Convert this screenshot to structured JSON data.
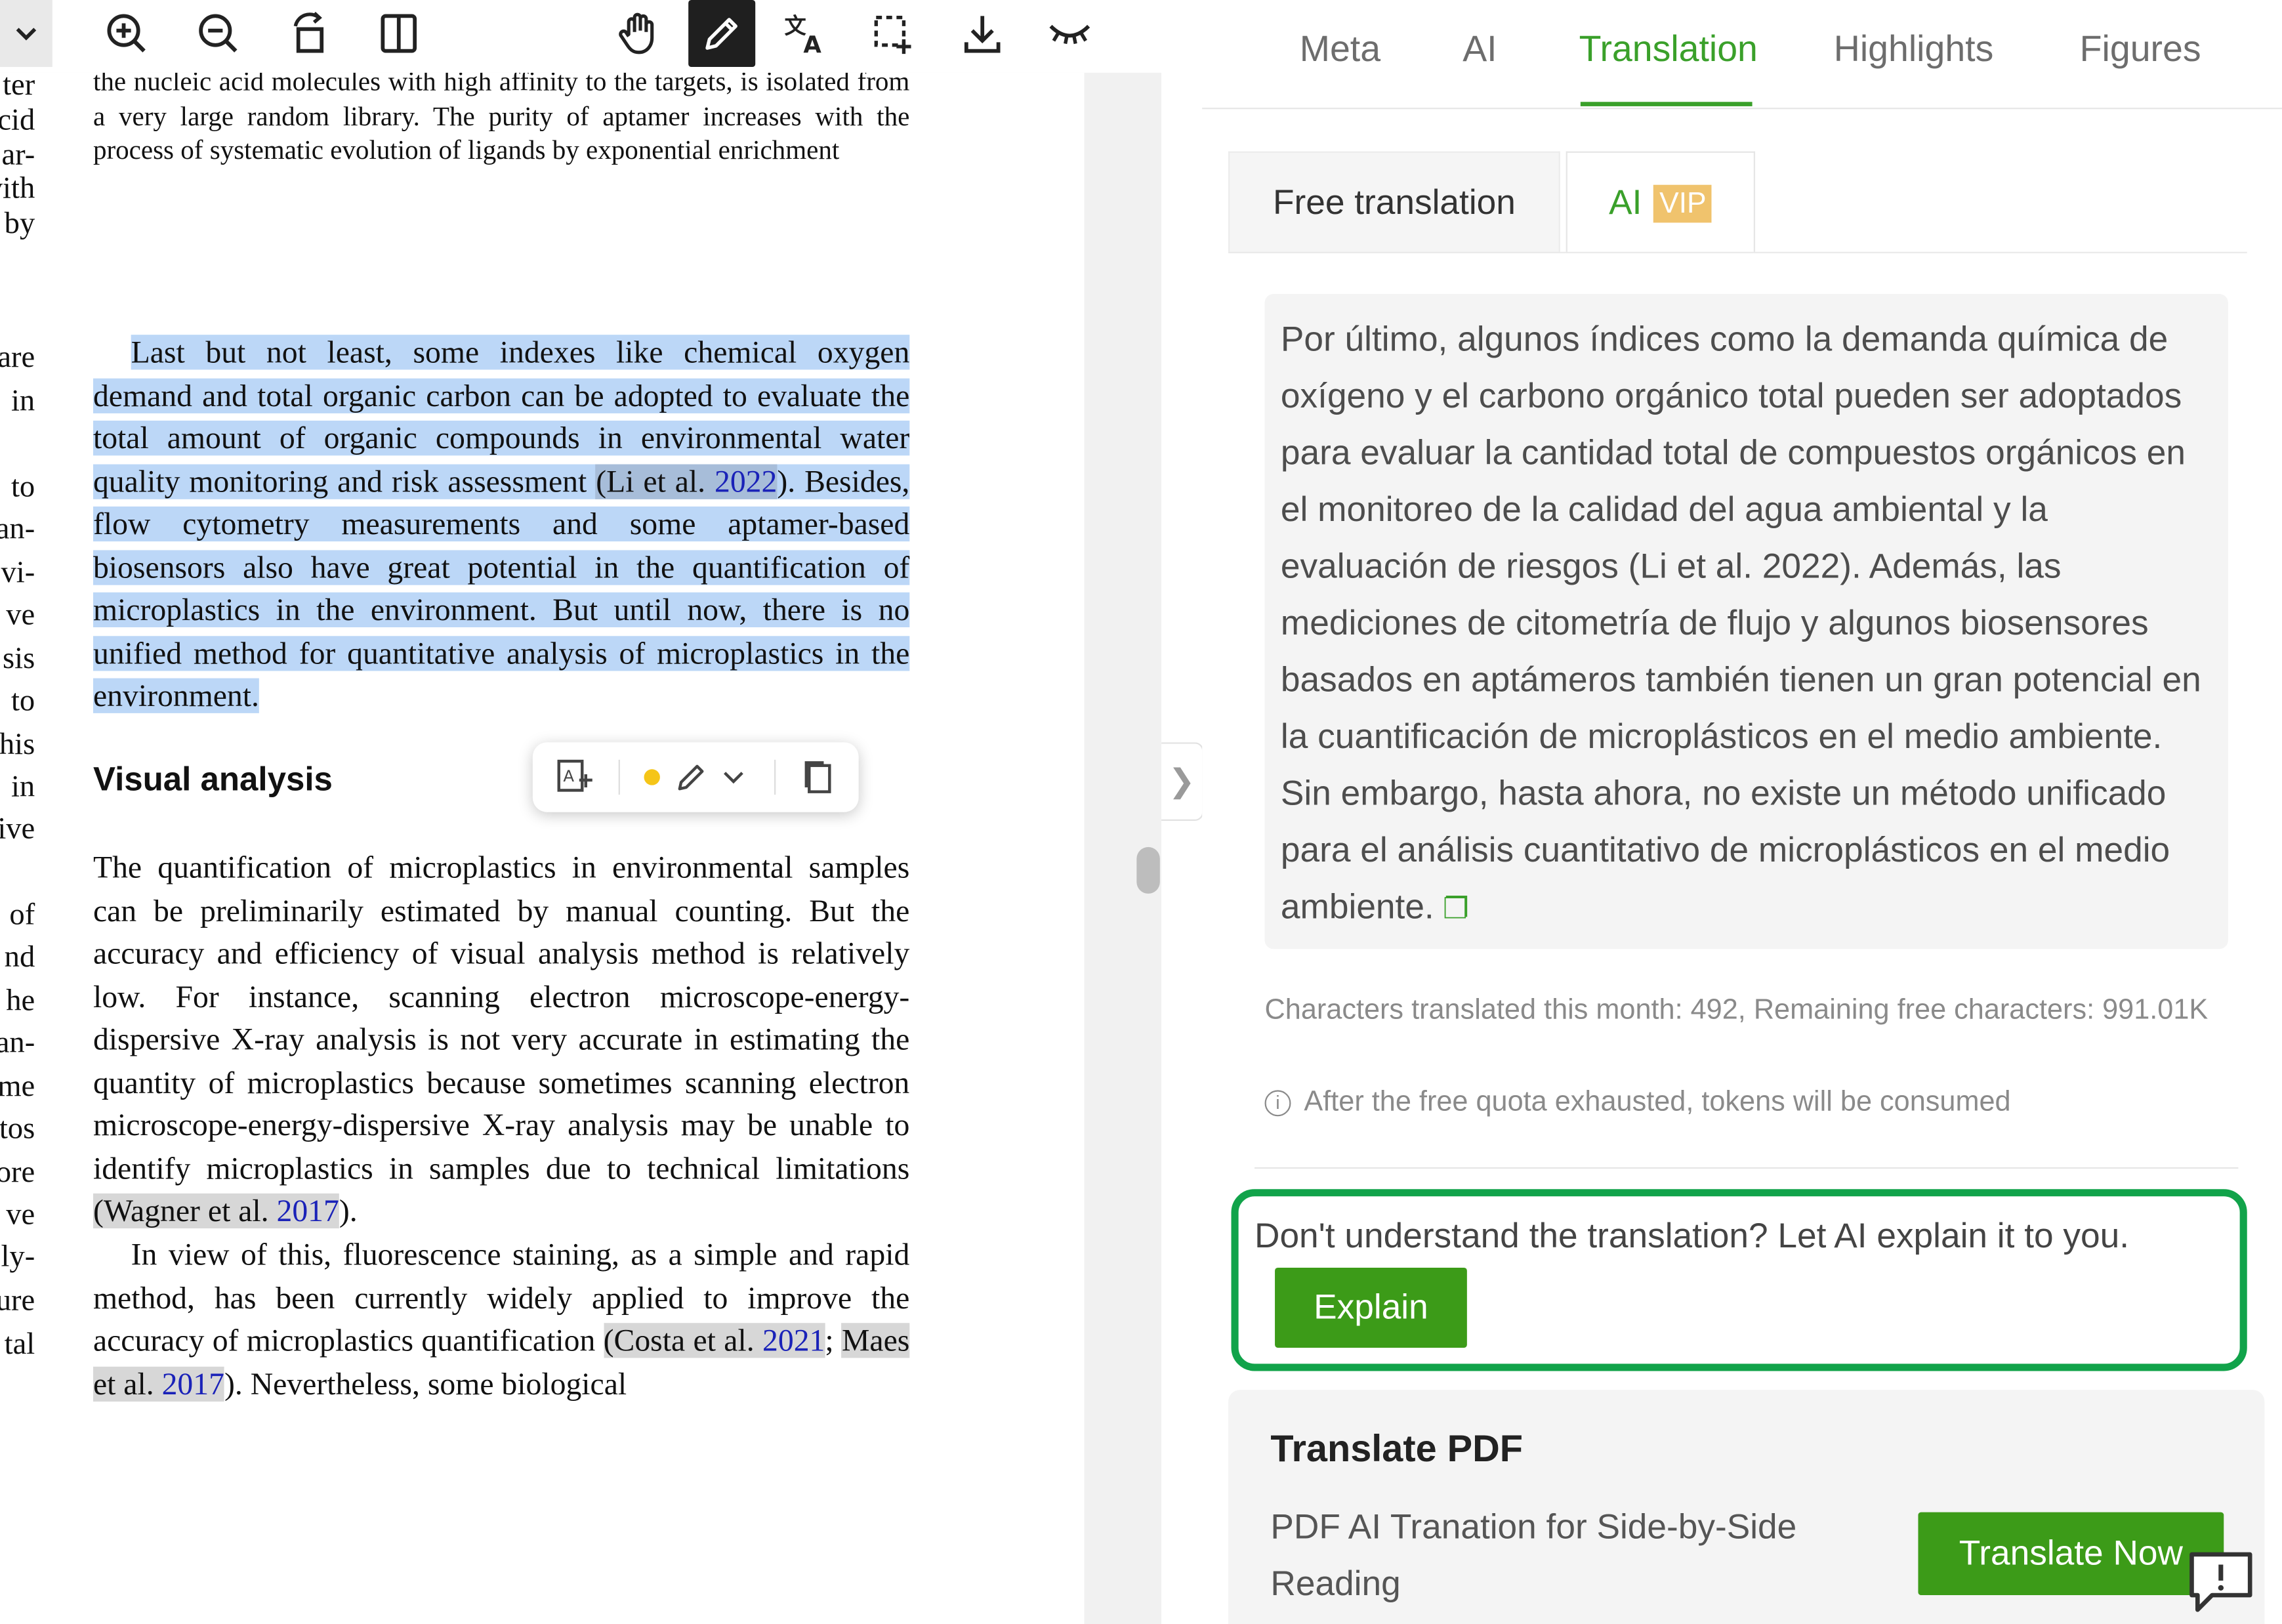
{
  "viewer": {
    "toolbar": {
      "dropdown_glyph": "⌄",
      "tools": [
        "zoom-in-icon",
        "zoom-out-icon",
        "rotate-icon",
        "split-view-icon",
        "hand-tool-icon",
        "pencil-icon",
        "translate-icon",
        "selection-icon",
        "download-icon",
        "hide-icon"
      ],
      "active_tool": "pencil-icon"
    },
    "left_column_fragments": [
      "ter",
      "cid",
      "ar-",
      "vith",
      "by",
      "are",
      "in",
      "to",
      "an-",
      "vi-",
      "ve",
      "sis",
      "to",
      "his",
      "in",
      "ive",
      "of",
      "nd",
      "he",
      "an-",
      "me",
      "tos",
      "ore",
      "ve",
      "ly-",
      "ure",
      "tal"
    ],
    "top_paragraph": "the nucleic acid molecules with high affinity to the targets, is isolated from a very large random library. The purity of aptamer increases with the process of systematic evolution of ligands by exponential enrichment",
    "selected_paragraph": {
      "text_a": "Last but not least, some indexes like chemical oxygen demand and total organic carbon can be adopted to evaluate the total amount of organic compounds in environmental water quality monitoring and risk assessment ",
      "cite_open": "(Li et al.",
      "cite_year": "2022",
      "text_b": "). Besides, flow cytometry measurements and some aptamer-based biosensors also have great potential in the quantification of microplastics in the environment. But until now, there is no unified method for quantitative analysis of microplastics in the environment."
    },
    "heading": "Visual analysis",
    "quant_paragraph": {
      "text": "The quantification of microplastics in environmental samples can be preliminarily estimated by manual counting. But the accuracy and efficiency of visual analysis method is relatively low. For instance, scanning electron microscope-energy-dispersive X-ray analysis is not very accurate in estimating the quantity of microplastics because sometimes scanning electron microscope-energy-dispersive X-ray analysis may be unable to identify microplastics in samples due to technical limitations ",
      "cite_author": "(Wagner et al. ",
      "cite_year": "2017",
      "cite_close": ")."
    },
    "view_paragraph": {
      "text": "In view of this, fluorescence staining, as a simple and rapid method, has been currently widely applied to improve the accuracy of microplastics quantification ",
      "cite1_author": "(Costa et al.",
      "cite1_year": "2021",
      "sep": "; ",
      "cite2_author": "Maes et al. ",
      "cite2_year": "2017",
      "tail": "). Nevertheless, some biological"
    },
    "floating_toolbar": [
      "translate-icon",
      "color-dot",
      "pencil-icon",
      "chevron-down-icon",
      "copy-icon"
    ],
    "collapse_glyph": "❯"
  },
  "panel": {
    "tabs": [
      {
        "label": "Meta"
      },
      {
        "label": "AI"
      },
      {
        "label": "Translation"
      },
      {
        "label": "Highlights"
      },
      {
        "label": "Figures"
      }
    ],
    "active_tab": "Translation",
    "subtabs": {
      "free": "Free translation",
      "ai": "AI",
      "vip": "VIP"
    },
    "translation_text": "Por último, algunos índices como la demanda química de oxígeno y el carbono orgánico total pueden ser adoptados para evaluar la cantidad total de compuestos orgánicos en el monitoreo de la calidad del agua ambiental y la evaluación de riesgos (Li et al. 2022). Además, las mediciones de citometría de flujo y algunos biosensores basados en aptámeros también tienen un gran potencial en la cuantificación de microplásticos en el medio ambiente. Sin embargo, hasta ahora, no existe un método unificado para el análisis cuantitativo de microplásticos en el medio ambiente.",
    "quota_text": "Characters translated this month: 492,  Remaining free characters: 991.01K",
    "info_text": "After the free quota exhausted, tokens will be consumed",
    "explain_prompt": "Don't understand the translation? Let AI explain it to you.",
    "explain_button": "Explain",
    "pdf_card": {
      "title": "Translate PDF",
      "description": "PDF AI Tranation for Side-by-Side Reading",
      "button": "Translate Now"
    },
    "colors": {
      "accent": "#3aa02a",
      "button": "#3c9b18",
      "explain_border": "#11a34a",
      "selection": "#bcd7f7",
      "vip": "#f0c36d"
    }
  }
}
